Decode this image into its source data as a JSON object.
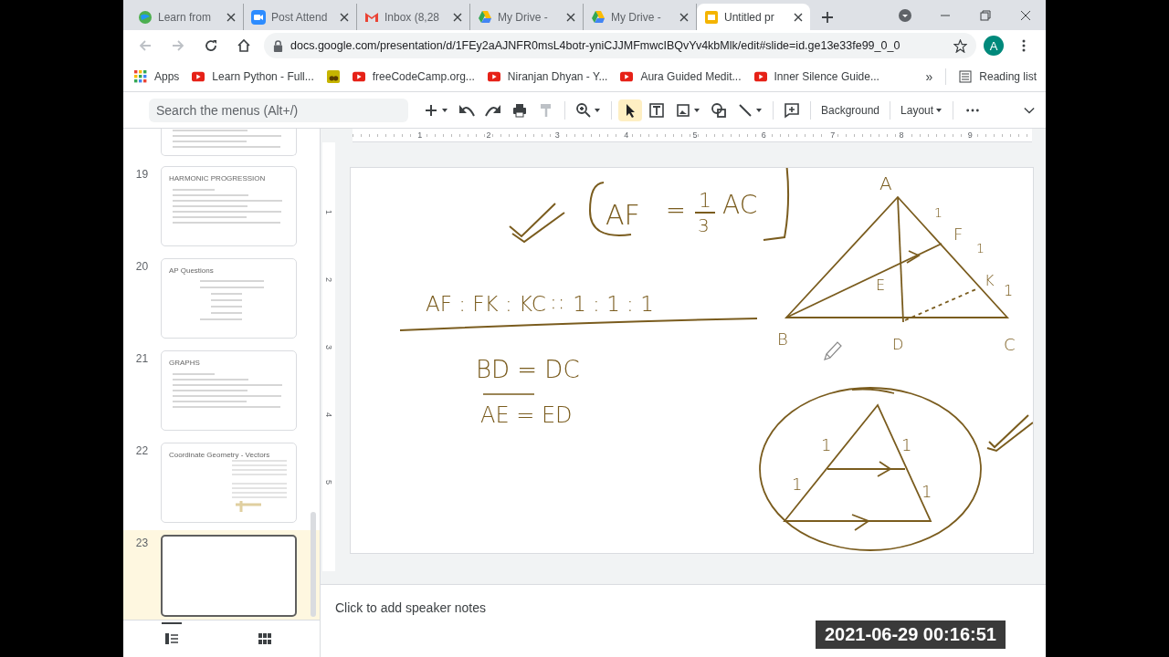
{
  "browser": {
    "tabs": [
      {
        "title": "Learn from",
        "kind": "globe",
        "selected": false
      },
      {
        "title": "Post Attend",
        "kind": "camera",
        "selected": false
      },
      {
        "title": "Inbox (8,28",
        "kind": "mail",
        "selected": false
      },
      {
        "title": "My Drive -",
        "kind": "drive",
        "selected": false
      },
      {
        "title": "My Drive -",
        "kind": "drive",
        "selected": false
      },
      {
        "title": "Untitled pr",
        "kind": "slides",
        "selected": true
      }
    ],
    "url": "docs.google.com/presentation/d/1FEy2aAJNFR0msL4botr-yniCJJMFmwcIBQvYv4kbMlk/edit#slide=id.ge13e33fe99_0_0",
    "avatar": "A",
    "bookmarks": [
      {
        "label": "Apps",
        "kind": "apps"
      },
      {
        "label": "Learn Python - Full...",
        "kind": "video"
      },
      {
        "kind": "tile"
      },
      {
        "label": "freeCodeCamp.org...",
        "kind": "video"
      },
      {
        "label": "Niranjan Dhyan - Y...",
        "kind": "video"
      },
      {
        "label": "Aura Guided Medit...",
        "kind": "video"
      },
      {
        "label": "Inner Silence Guide...",
        "kind": "video"
      }
    ],
    "more": "»",
    "reading_list": "Reading list"
  },
  "toolbar": {
    "search_placeholder": "Search the menus (Alt+/)",
    "tools": [
      {
        "kind": "add",
        "selected": false
      },
      {
        "kind": "undo",
        "selected": false
      },
      {
        "kind": "redo",
        "selected": false
      },
      {
        "kind": "print",
        "selected": false
      },
      {
        "kind": "paint",
        "selected": false
      },
      {
        "kind": "zoom",
        "selected": false
      },
      {
        "kind": "select",
        "selected": true
      },
      {
        "kind": "textbox",
        "selected": false
      },
      {
        "kind": "image",
        "selected": false
      },
      {
        "kind": "shape",
        "selected": false
      },
      {
        "kind": "line",
        "selected": false
      },
      {
        "kind": "comment",
        "selected": false
      }
    ],
    "background": "Background",
    "layout": "Layout"
  },
  "ruler": [
    "1",
    "2",
    "3",
    "4",
    "5",
    "6",
    "7",
    "8",
    "9"
  ],
  "vertical_ruler": [
    "1",
    "2",
    "3",
    "4",
    "5"
  ],
  "filmstrip": [
    {
      "partial": true,
      "kind": "bullets",
      "selected": false
    },
    {
      "number": "19",
      "title": "HARMONIC PROGRESSION",
      "kind": "bullets",
      "selected": false
    },
    {
      "number": "20",
      "title": "AP Questions",
      "kind": "centered",
      "selected": false
    },
    {
      "number": "21",
      "title": "GRAPHS",
      "kind": "bullets",
      "selected": false
    },
    {
      "number": "22",
      "title": "Coordinate Geometry - Vectors",
      "kind": "twocol",
      "selected": false
    },
    {
      "number": "23",
      "kind": "blank",
      "selected": true
    }
  ],
  "views": [
    {
      "kind": "list",
      "selected": true
    },
    {
      "kind": "grid",
      "selected": false
    }
  ],
  "slide": {
    "annotations": [
      {
        "text": "AF"
      },
      {
        "text": "="
      },
      {
        "text": "1"
      },
      {
        "text": "3"
      },
      {
        "text": "AC"
      },
      {
        "text": "AF : FK : KC ∷ 1 : 1 : 1"
      },
      {
        "text": "BD = DC"
      },
      {
        "text": "AE = ED"
      },
      {
        "text": "A"
      },
      {
        "text": "F"
      },
      {
        "text": "E"
      },
      {
        "text": "K"
      },
      {
        "text": "B"
      },
      {
        "text": "D"
      },
      {
        "text": "C"
      },
      {
        "text": "1"
      },
      {
        "text": "1"
      },
      {
        "text": "1"
      },
      {
        "text": "1"
      },
      {
        "text": "1"
      },
      {
        "text": "1"
      },
      {
        "text": "1"
      }
    ]
  },
  "speaker_notes": {
    "prompt": "Click to add speaker notes"
  },
  "timestamp": "2021-06-29 00:16:51"
}
